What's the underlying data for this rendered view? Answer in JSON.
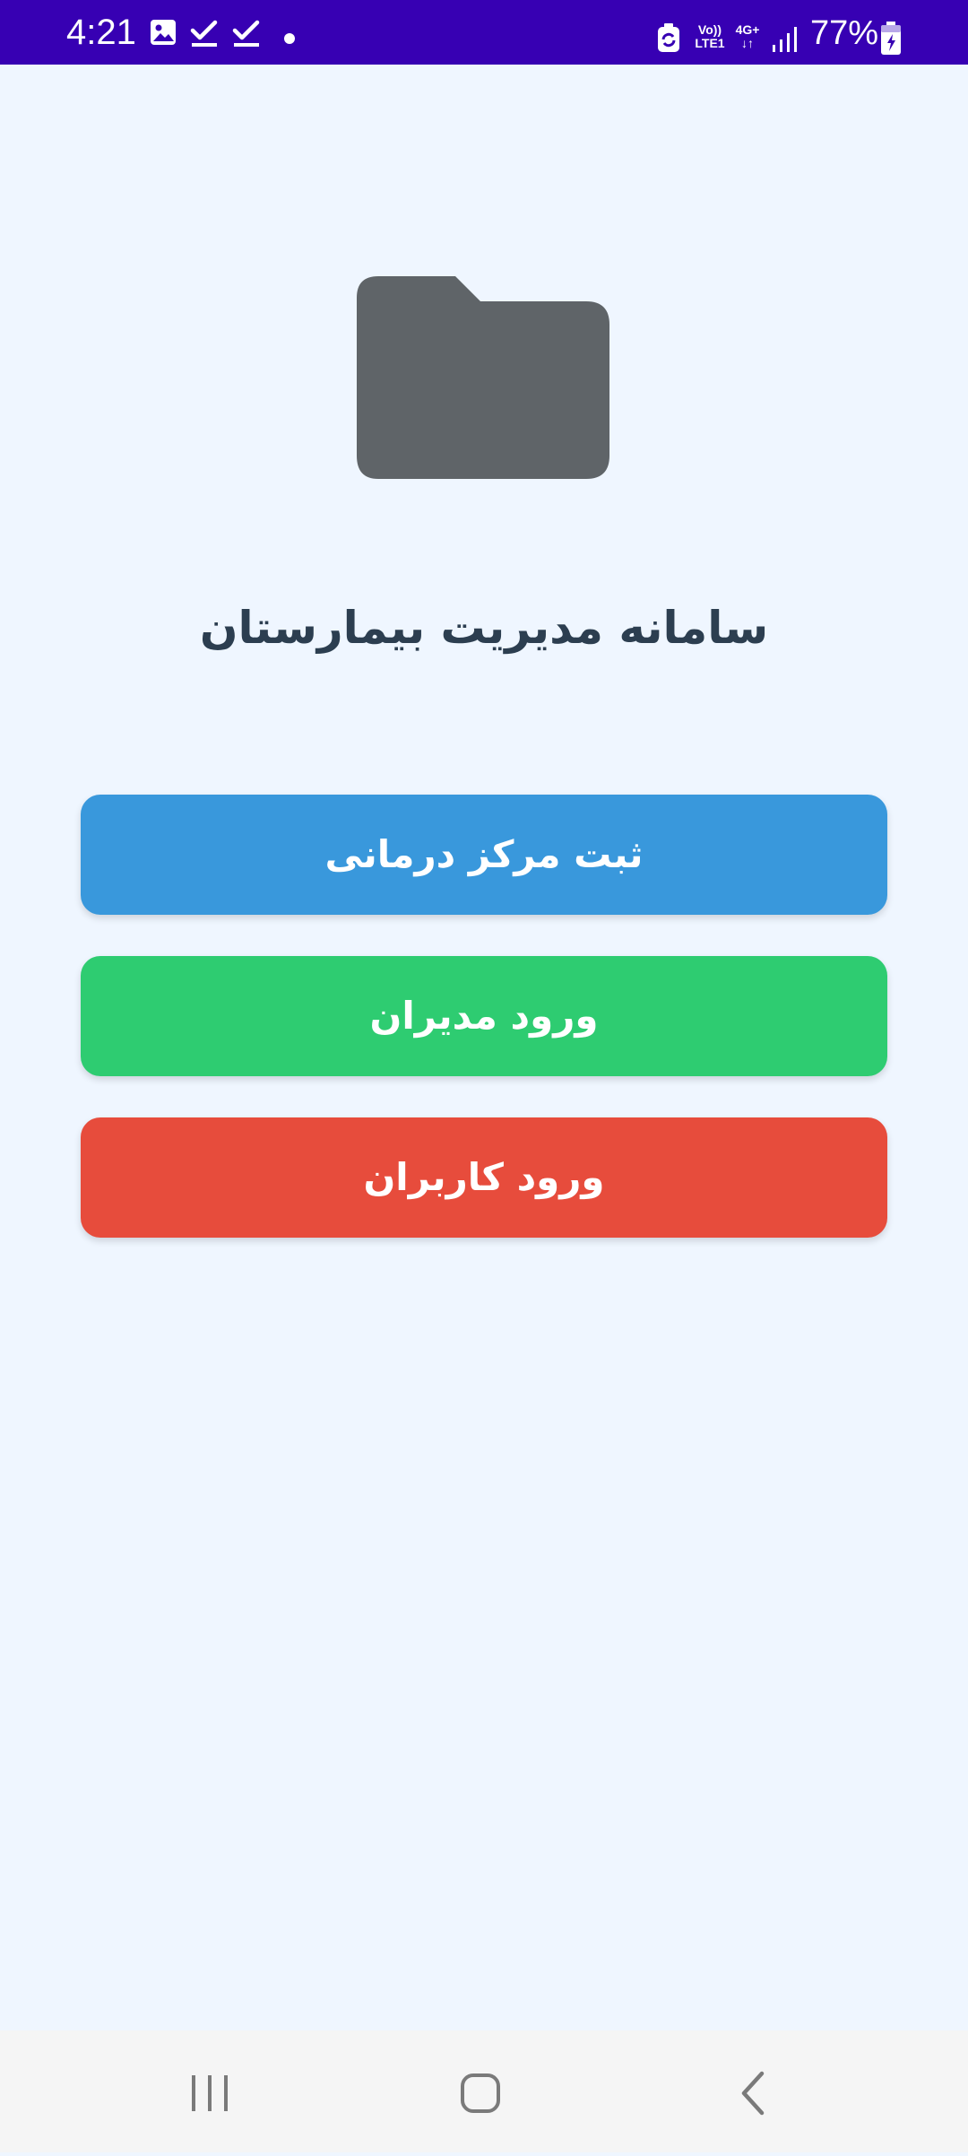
{
  "status_bar": {
    "time": "4:21",
    "battery_percent": "77%",
    "network_volte": "Vo))",
    "network_lte": "LTE1",
    "network_type": "4G+",
    "icons": [
      "gallery-icon",
      "check-icon",
      "check-icon",
      "dot-icon",
      "sync-icon",
      "signal-icon",
      "battery-icon"
    ]
  },
  "app": {
    "logo_icon": "folder-icon",
    "title": "سامانه مدیریت بیمارستان"
  },
  "buttons": {
    "register_center": "ثبت مرکز درمانی",
    "managers_login": "ورود مدیران",
    "users_login": "ورود کاربران"
  },
  "nav_bar": {
    "icons": [
      "recent-apps-icon",
      "home-icon",
      "back-icon"
    ]
  },
  "colors": {
    "status_bar": "#3700b3",
    "background": "#eff6ff",
    "title_text": "#2c3e50",
    "folder": "#5f6468",
    "register_button": "#3998dc",
    "managers_button": "#2ecc71",
    "users_button": "#e74c3c"
  }
}
